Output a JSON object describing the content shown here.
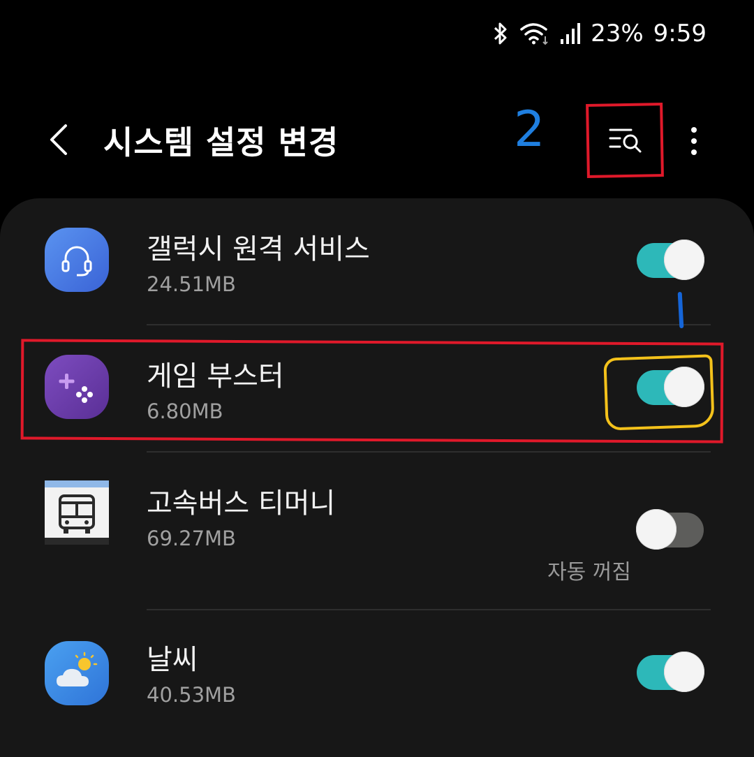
{
  "status_bar": {
    "battery": "23%",
    "time": "9:59",
    "icons": [
      "bluetooth-icon",
      "wifi-icon",
      "cell-signal-icon"
    ]
  },
  "header": {
    "title": "시스템 설정 변경",
    "back_icon": "chevron-left-icon",
    "search_icon": "search-list-icon",
    "more_icon": "more-vertical-icon"
  },
  "annotations": {
    "label_2": "2",
    "colors": {
      "red": "#e0192a",
      "blue": "#1f7fe0",
      "yellow": "#f4c21b"
    }
  },
  "apps": [
    {
      "name": "갤럭시 원격 서비스",
      "size": "24.51MB",
      "enabled": true,
      "icon": "headset-icon",
      "icon_color": "#4a7ce8"
    },
    {
      "name": "게임 부스터",
      "size": "6.80MB",
      "enabled": true,
      "icon": "gamepad-icon",
      "icon_color": "#6b3fa8"
    },
    {
      "name": "고속버스 티머니",
      "size": "69.27MB",
      "enabled": false,
      "note": "자동 꺼짐",
      "icon": "bus-icon",
      "icon_color": "#f2f2f2"
    },
    {
      "name": "날씨",
      "size": "40.53MB",
      "enabled": true,
      "icon": "weather-cloud-sun-icon",
      "icon_color": "#3b8ae6"
    }
  ],
  "colors": {
    "toggle_on": "#2db8b9",
    "toggle_off": "#5d5d5b",
    "background": "#000000",
    "card": "#171717"
  }
}
